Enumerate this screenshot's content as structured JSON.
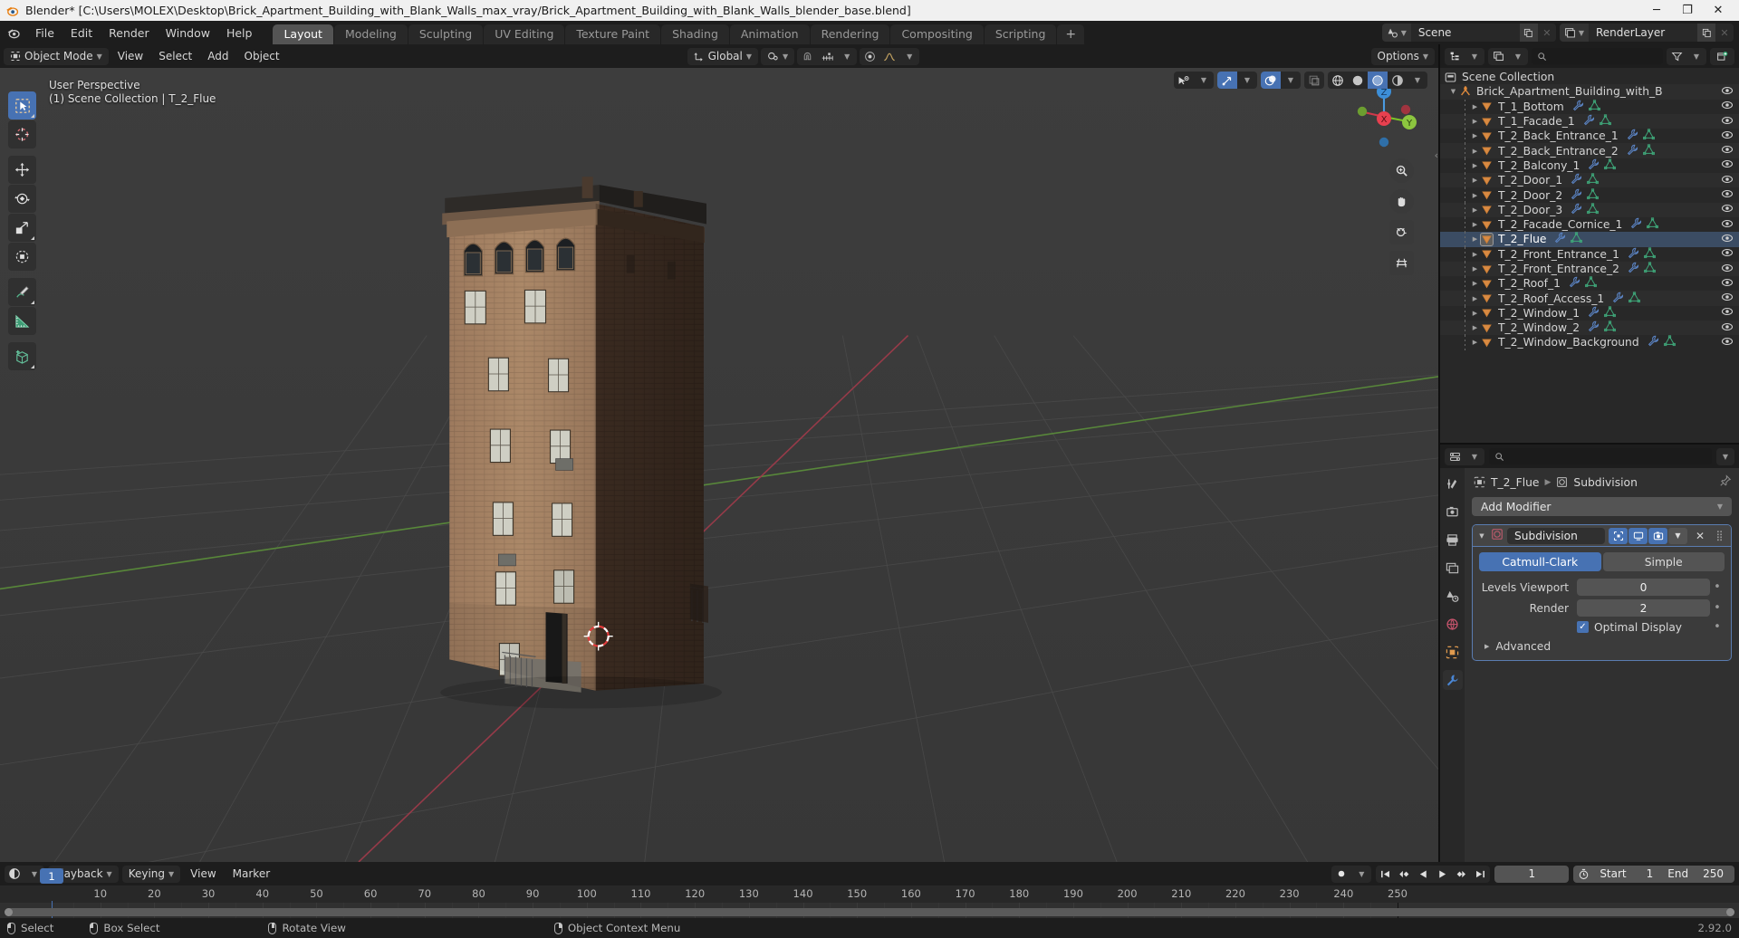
{
  "window": {
    "title": "Blender* [C:\\Users\\MOLEX\\Desktop\\Brick_Apartment_Building_with_Blank_Walls_max_vray/Brick_Apartment_Building_with_Blank_Walls_blender_base.blend]",
    "minimize": "─",
    "maximize": "❐",
    "close": "✕"
  },
  "topbar": {
    "menus": [
      "File",
      "Edit",
      "Render",
      "Window",
      "Help"
    ],
    "workspace_tabs": [
      {
        "label": "Layout",
        "active": true
      },
      {
        "label": "Modeling",
        "active": false
      },
      {
        "label": "Sculpting",
        "active": false
      },
      {
        "label": "UV Editing",
        "active": false
      },
      {
        "label": "Texture Paint",
        "active": false
      },
      {
        "label": "Shading",
        "active": false
      },
      {
        "label": "Animation",
        "active": false
      },
      {
        "label": "Rendering",
        "active": false
      },
      {
        "label": "Compositing",
        "active": false
      },
      {
        "label": "Scripting",
        "active": false
      }
    ],
    "add_workspace": "+",
    "scene_name": "Scene",
    "viewlayer_name": "RenderLayer"
  },
  "viewport": {
    "mode": "Object Mode",
    "menus": [
      "View",
      "Select",
      "Add",
      "Object"
    ],
    "transform_orientation": "Global",
    "options_label": "Options",
    "overlay_line1": "User Perspective",
    "overlay_line2": "(1) Scene Collection | T_2_Flue",
    "gizmo_axes": [
      "X",
      "Y",
      "Z"
    ],
    "tools": [
      "tweak-select-tool",
      "cursor-tool",
      "move-tool",
      "rotate-tool",
      "scale-tool",
      "transform-tool",
      "annotate-tool",
      "measure-tool",
      "add-cube-tool"
    ],
    "nav_buttons": [
      "zoom-icon",
      "pan-hand-icon",
      "camera-icon",
      "grid-ortho-icon"
    ]
  },
  "outliner": {
    "scene_collection": "Scene Collection",
    "collection_name": "Brick_Apartment_Building_with_Blank_Walls",
    "items": [
      {
        "label": "T_1_Bottom",
        "selected": false
      },
      {
        "label": "T_1_Facade_1",
        "selected": false
      },
      {
        "label": "T_2_Back_Entrance_1",
        "selected": false
      },
      {
        "label": "T_2_Back_Entrance_2",
        "selected": false
      },
      {
        "label": "T_2_Balcony_1",
        "selected": false
      },
      {
        "label": "T_2_Door_1",
        "selected": false
      },
      {
        "label": "T_2_Door_2",
        "selected": false
      },
      {
        "label": "T_2_Door_3",
        "selected": false
      },
      {
        "label": "T_2_Facade_Cornice_1",
        "selected": false
      },
      {
        "label": "T_2_Flue",
        "selected": true
      },
      {
        "label": "T_2_Front_Entrance_1",
        "selected": false
      },
      {
        "label": "T_2_Front_Entrance_2",
        "selected": false
      },
      {
        "label": "T_2_Roof_1",
        "selected": false
      },
      {
        "label": "T_2_Roof_Access_1",
        "selected": false
      },
      {
        "label": "T_2_Window_1",
        "selected": false
      },
      {
        "label": "T_2_Window_2",
        "selected": false
      },
      {
        "label": "T_2_Window_Background",
        "selected": false
      }
    ]
  },
  "properties": {
    "breadcrumb_object": "T_2_Flue",
    "breadcrumb_modifier": "Subdivision",
    "add_modifier": "Add Modifier",
    "modifier": {
      "name": "Subdivision",
      "type_options": [
        "Catmull-Clark",
        "Simple"
      ],
      "type_selected": "Catmull-Clark",
      "levels_viewport_label": "Levels Viewport",
      "levels_viewport_value": "0",
      "render_label": "Render",
      "render_value": "2",
      "optimal_display_label": "Optimal Display",
      "optimal_display_checked": true,
      "advanced_label": "Advanced"
    },
    "tabs": [
      "tool-icon",
      "render-icon",
      "output-icon",
      "viewlayer-icon",
      "scene-icon",
      "world-icon",
      "object-icon",
      "modifier-wrench-icon"
    ]
  },
  "timeline": {
    "menus": [
      "Playback",
      "Keying",
      "View",
      "Marker"
    ],
    "current_frame": "1",
    "start_label": "Start",
    "start_value": "1",
    "end_label": "End",
    "end_value": "250",
    "playhead_label": "1",
    "ticks": [
      10,
      20,
      30,
      40,
      50,
      60,
      70,
      80,
      90,
      100,
      110,
      120,
      130,
      140,
      150,
      160,
      170,
      180,
      190,
      200,
      210,
      220,
      230,
      240,
      250
    ]
  },
  "statusbar": {
    "items": [
      {
        "mouse": "left",
        "label": "Select"
      },
      {
        "mouse": "left-drag",
        "label": "Box Select"
      },
      {
        "mouse": "middle",
        "label": "Rotate View"
      },
      {
        "mouse": "right",
        "label": "Object Context Menu"
      }
    ],
    "version": "2.92.0"
  },
  "colors": {
    "accent_blue": "#4772b3",
    "panel_bg": "#303030",
    "header_bg": "#1d1d1d",
    "viewport_bg": "#393939",
    "object_orange": "#e08a3c",
    "mesh_green": "#3fa87a",
    "modifier_blue": "#5a7cb0"
  }
}
